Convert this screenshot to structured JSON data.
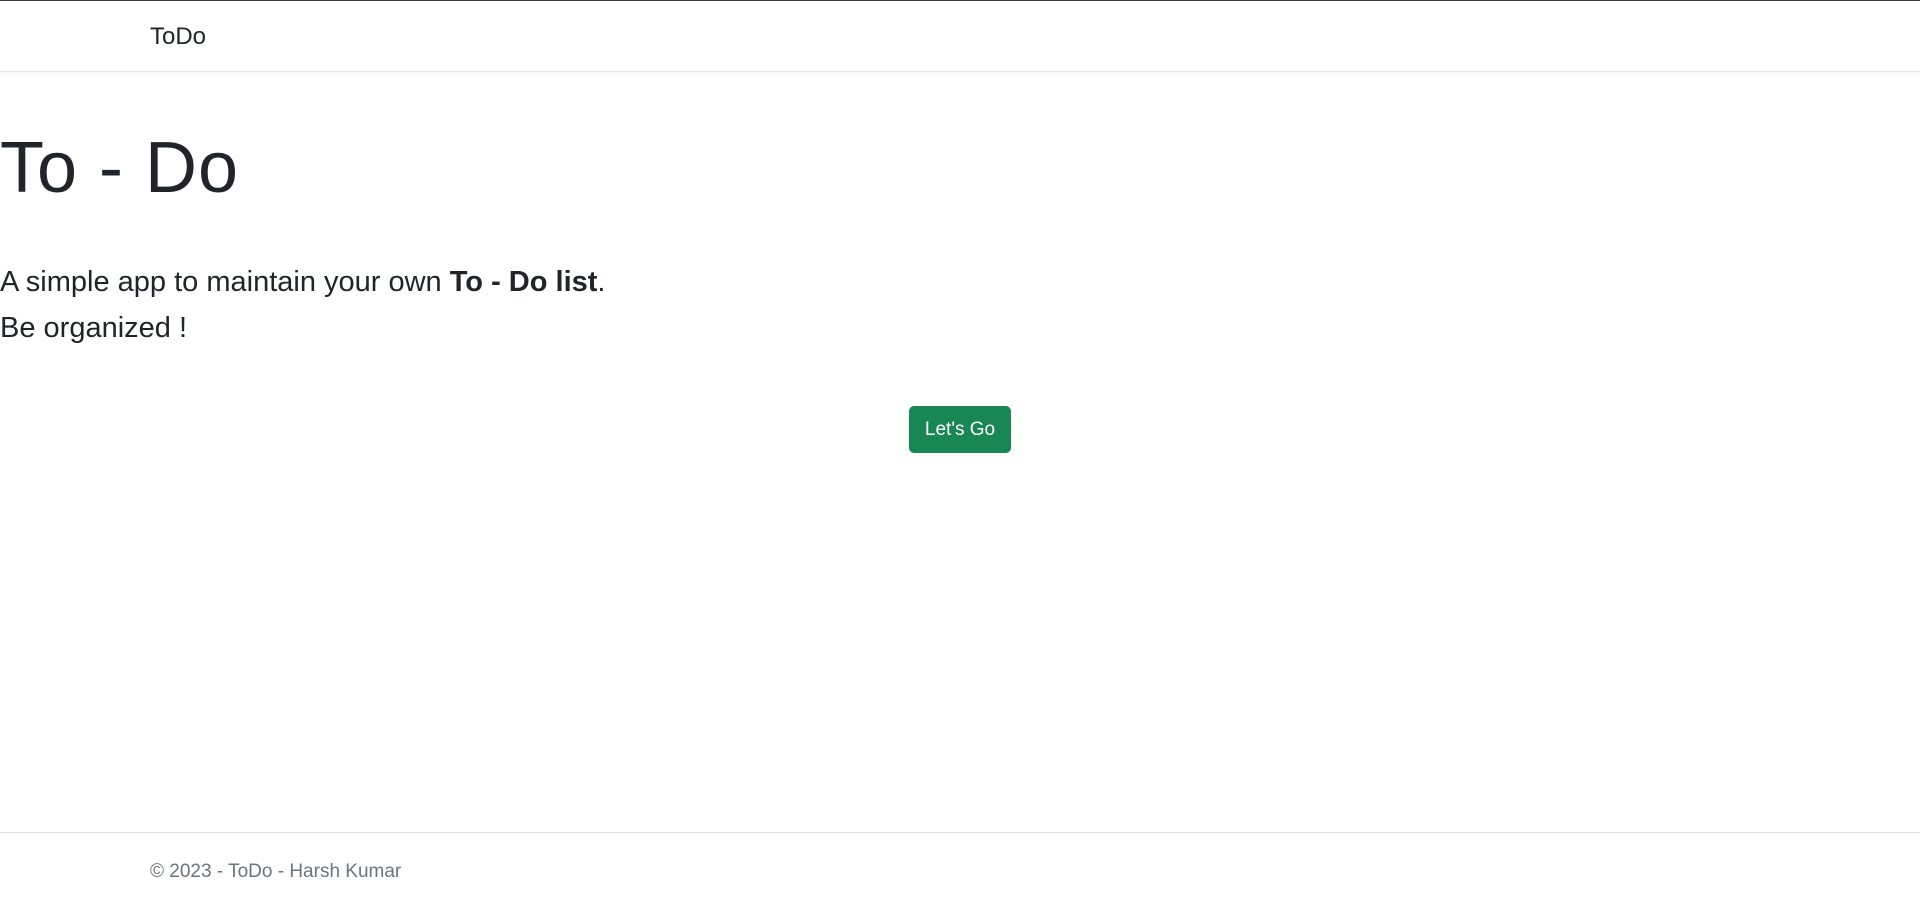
{
  "navbar": {
    "brand": "ToDo"
  },
  "hero": {
    "title": "To - Do",
    "lead_prefix": "A simple app to maintain your own ",
    "lead_bold": "To - Do list",
    "lead_suffix": ".",
    "lead_line2": "Be organized !",
    "cta_label": "Let's Go"
  },
  "footer": {
    "text": "© 2023 - ToDo - Harsh Kumar"
  },
  "colors": {
    "primary_green": "#198754",
    "text_dark": "#212529",
    "text_muted": "#6c757d"
  }
}
